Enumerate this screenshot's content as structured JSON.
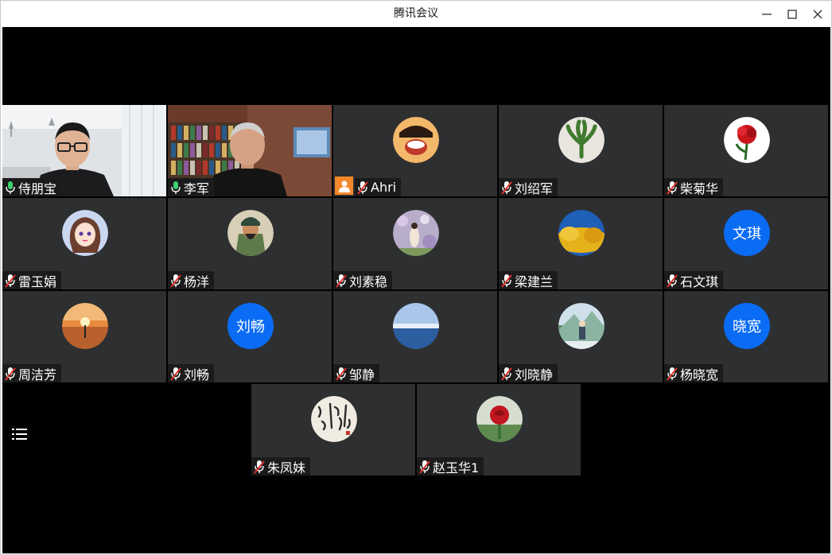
{
  "window": {
    "title": "腾讯会议",
    "controls": [
      "minimize-icon",
      "maximize-icon",
      "close-icon"
    ]
  },
  "participants": [
    {
      "name": "侍朋宝",
      "mic": "on",
      "media": "video-person-office"
    },
    {
      "name": "李军",
      "mic": "on",
      "media": "video-person-bookshelf",
      "active_speaker": true
    },
    {
      "name": "Ahri",
      "mic": "muted",
      "media": "avatar-cartoon",
      "host": true
    },
    {
      "name": "刘绍军",
      "mic": "muted",
      "media": "avatar-plant"
    },
    {
      "name": "柴菊华",
      "mic": "muted",
      "media": "avatar-carnation"
    },
    {
      "name": "雷玉娟",
      "mic": "muted",
      "media": "avatar-anime-girl"
    },
    {
      "name": "杨洋",
      "mic": "muted",
      "media": "avatar-warrior"
    },
    {
      "name": "刘素稳",
      "mic": "muted",
      "media": "avatar-flowers"
    },
    {
      "name": "梁建兰",
      "mic": "muted",
      "media": "avatar-yellow-tree"
    },
    {
      "name": "石文琪",
      "mic": "muted",
      "media": "avatar-text",
      "avatar_text": "文琪"
    },
    {
      "name": "周洁芳",
      "mic": "muted",
      "media": "avatar-sunset"
    },
    {
      "name": "刘畅",
      "mic": "muted",
      "media": "avatar-text",
      "avatar_text": "刘畅"
    },
    {
      "name": "邹静",
      "mic": "muted",
      "media": "avatar-lake"
    },
    {
      "name": "刘晓静",
      "mic": "muted",
      "media": "avatar-outdoor"
    },
    {
      "name": "杨晓宽",
      "mic": "muted",
      "media": "avatar-text",
      "avatar_text": "晓宽"
    },
    {
      "name": "朱凤妹",
      "mic": "muted",
      "media": "avatar-calligraphy"
    },
    {
      "name": "赵玉华1",
      "mic": "muted",
      "media": "avatar-rose"
    }
  ],
  "colors": {
    "tile_bg": "#2e2f31",
    "stage_bg": "#000000",
    "text_avatar_bg": "#0a6cf5",
    "host_badge": "#f2882b",
    "mic_on": "#3bd16f",
    "mic_muted": "#e0312c"
  },
  "toolbar": {
    "list_icon": "list-icon"
  }
}
